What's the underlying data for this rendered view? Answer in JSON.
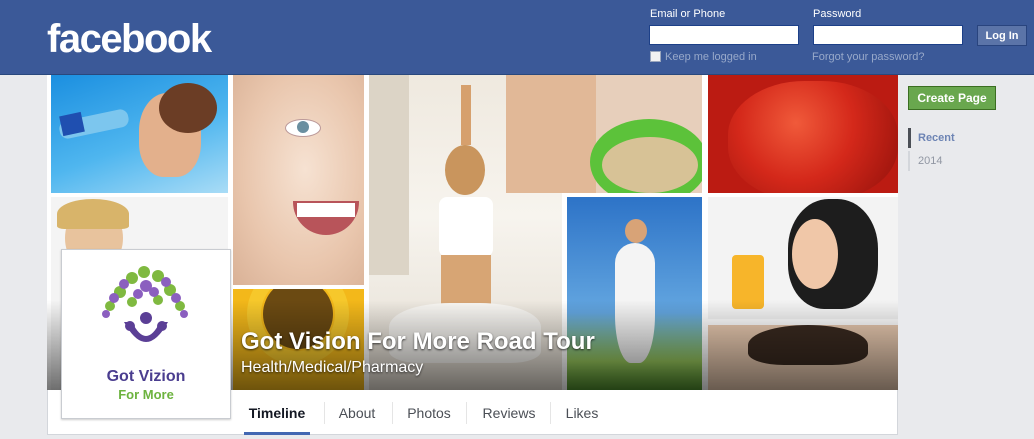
{
  "header": {
    "logo": "facebook",
    "email_label": "Email or Phone",
    "password_label": "Password",
    "email_value": "",
    "password_value": "",
    "keep_logged_in": "Keep me logged in",
    "forgot_password": "Forgot your password?",
    "login_button": "Log In"
  },
  "page": {
    "title": "Got Vision For More Road Tour",
    "category": "Health/Medical/Pharmacy",
    "profile_text_line1": "Got Vizion",
    "profile_text_line2": "For More"
  },
  "tabs": [
    "Timeline",
    "About",
    "Photos",
    "Reviews",
    "Likes"
  ],
  "sidebar": {
    "create_page": "Create Page",
    "recent": "Recent",
    "year": "2014"
  },
  "colors": {
    "facebook_blue": "#3b5998",
    "create_green": "#69a74e",
    "tab_underline": "#4267b2"
  }
}
